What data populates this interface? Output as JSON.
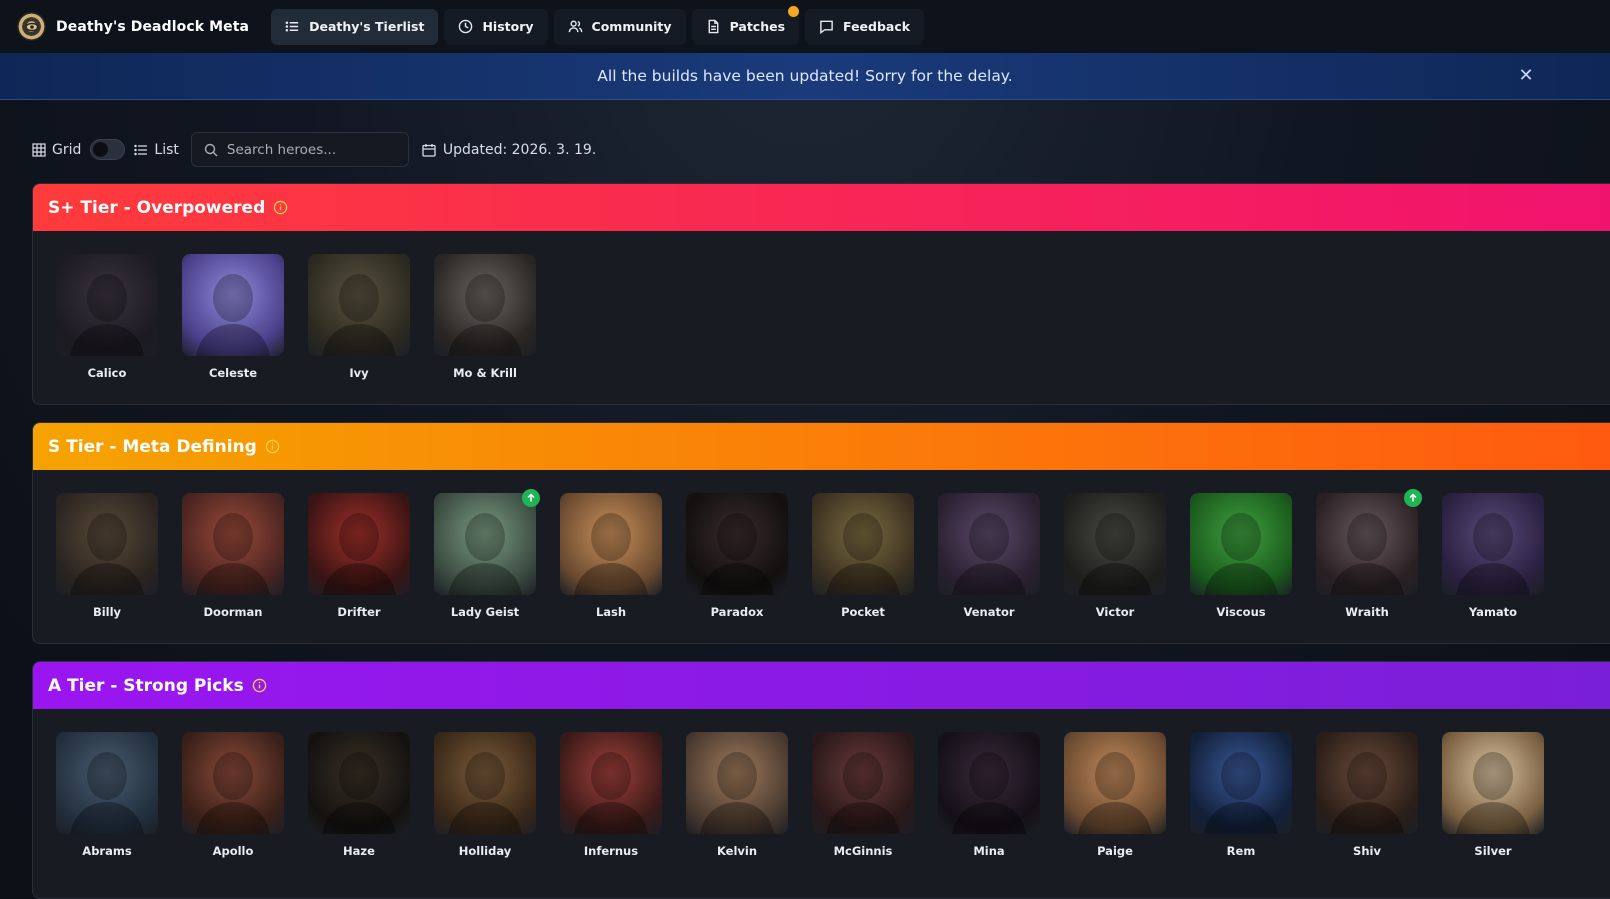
{
  "app": {
    "title": "Deathy's Deadlock Meta",
    "logo_icon": "eye-logo-icon"
  },
  "nav": {
    "tabs": [
      {
        "label": "Deathy's Tierlist",
        "icon": "list-icon",
        "active": true
      },
      {
        "label": "History",
        "icon": "clock-icon"
      },
      {
        "label": "Community",
        "icon": "users-icon"
      },
      {
        "label": "Patches",
        "icon": "document-icon",
        "has_notification": true
      },
      {
        "label": "Feedback",
        "icon": "chat-icon"
      }
    ]
  },
  "banner": {
    "text": "All the builds have been updated! Sorry for the delay.",
    "close_icon": "close-icon"
  },
  "controls": {
    "grid_label": "Grid",
    "list_label": "List",
    "view_toggle_on": false,
    "search_placeholder": "Search heroes...",
    "updated_text": "Updated: 2026. 3. 19."
  },
  "tiers": [
    {
      "title": "S+ Tier - Overpowered",
      "gradient": [
        "#ff3b3b",
        "#f0136e"
      ],
      "info_color": "#ffd24a",
      "heroes": [
        {
          "name": "Calico",
          "colors": [
            "#3a3440",
            "#1c1a22"
          ]
        },
        {
          "name": "Celeste",
          "colors": [
            "#8f8bd9",
            "#4a3f8a"
          ]
        },
        {
          "name": "Ivy",
          "colors": [
            "#5a5240",
            "#2c2a20"
          ]
        },
        {
          "name": "Mo & Krill",
          "colors": [
            "#6a6460",
            "#2a2624"
          ]
        }
      ]
    },
    {
      "title": "S Tier - Meta Defining",
      "gradient": [
        "#f5a300",
        "#ff5a10"
      ],
      "info_color": "#ffd24a",
      "heroes": [
        {
          "name": "Billy",
          "colors": [
            "#5a4a3a",
            "#2a2420"
          ]
        },
        {
          "name": "Doorman",
          "colors": [
            "#9a4a3a",
            "#4a2420"
          ]
        },
        {
          "name": "Drifter",
          "colors": [
            "#a0302a",
            "#3a1414"
          ]
        },
        {
          "name": "Lady Geist",
          "colors": [
            "#7a9a80",
            "#3a4a40"
          ],
          "trending_up": true
        },
        {
          "name": "Lash",
          "colors": [
            "#c9905a",
            "#6a4a30"
          ]
        },
        {
          "name": "Paradox",
          "colors": [
            "#3a2a2e",
            "#12100f"
          ]
        },
        {
          "name": "Pocket",
          "colors": [
            "#7a6a40",
            "#3a3020"
          ]
        },
        {
          "name": "Venator",
          "colors": [
            "#5a4a6a",
            "#2a2030"
          ]
        },
        {
          "name": "Victor",
          "colors": [
            "#4a4a44",
            "#1e1e1c"
          ]
        },
        {
          "name": "Viscous",
          "colors": [
            "#3fa040",
            "#1a5a1c"
          ]
        },
        {
          "name": "Wraith",
          "colors": [
            "#6a5a60",
            "#2a2024"
          ],
          "trending_up": true
        },
        {
          "name": "Yamato",
          "colors": [
            "#5a4a7a",
            "#2a2040"
          ]
        }
      ]
    },
    {
      "title": "A Tier - Strong Picks",
      "gradient": [
        "#9a16f0",
        "#7a1fd8"
      ],
      "info_color": "#ffd24a",
      "heroes": [
        {
          "name": "Abrams",
          "colors": [
            "#4a5a70",
            "#22303e"
          ]
        },
        {
          "name": "Apollo",
          "colors": [
            "#8a4a3a",
            "#3a2018"
          ]
        },
        {
          "name": "Haze",
          "colors": [
            "#3a3024",
            "#141210"
          ]
        },
        {
          "name": "Holliday",
          "colors": [
            "#7a5a3a",
            "#3a2818"
          ]
        },
        {
          "name": "Infernus",
          "colors": [
            "#a0403a",
            "#3a1a18"
          ]
        },
        {
          "name": "Kelvin",
          "colors": [
            "#a07a5a",
            "#4a3a30"
          ]
        },
        {
          "name": "McGinnis",
          "colors": [
            "#6a3a3a",
            "#2a1818"
          ]
        },
        {
          "name": "Mina",
          "colors": [
            "#3a2a3a",
            "#141018"
          ]
        },
        {
          "name": "Paige",
          "colors": [
            "#c08a5a",
            "#6a4a30"
          ]
        },
        {
          "name": "Rem",
          "colors": [
            "#3a5a9a",
            "#12203a"
          ]
        },
        {
          "name": "Shiv",
          "colors": [
            "#6a4a3a",
            "#2a1e18"
          ]
        },
        {
          "name": "Silver",
          "colors": [
            "#d8c0a0",
            "#7a6040"
          ]
        }
      ]
    }
  ]
}
